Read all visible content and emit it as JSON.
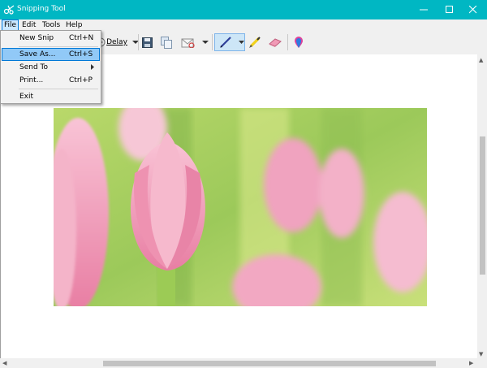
{
  "window": {
    "title": "Snipping Tool"
  },
  "menubar": {
    "items": [
      "File",
      "Edit",
      "Tools",
      "Help"
    ]
  },
  "toolbar": {
    "delay_label": "Delay"
  },
  "file_menu": {
    "items": [
      {
        "label": "New Snip",
        "shortcut": "Ctrl+N"
      },
      {
        "label": "Save As...",
        "shortcut": "Ctrl+S"
      },
      {
        "label": "Send To",
        "shortcut": ""
      },
      {
        "label": "Print...",
        "shortcut": "Ctrl+P"
      },
      {
        "label": "Exit",
        "shortcut": ""
      }
    ],
    "highlighted_index": 1
  },
  "colors": {
    "titlebar": "#00b7c3",
    "highlight": "#91c9f7",
    "accent": "#0078d7"
  }
}
